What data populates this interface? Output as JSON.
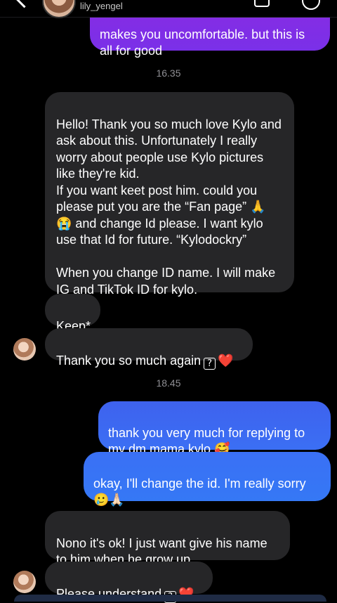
{
  "header": {
    "username": "lily_yengel"
  },
  "messages": [
    {
      "id": "m0",
      "type": "sent",
      "text": "makes you uncomfortable. but this is\nall for good"
    },
    {
      "id": "t1",
      "type": "time",
      "text": "16.35"
    },
    {
      "id": "m1",
      "type": "received",
      "text": "Hello! Thank you so much love Kylo and ask about this. Unfortunately I really worry about people use Kylo pictures like they're kid.\nIf you want keet post him. could you please put you are the “Fan page” 🙏 😭 and change Id please. I want kylo use that Id for future. “Kylodockry”\n\nWhen you change ID name. I will make IG and TikTok ID for kylo."
    },
    {
      "id": "m2",
      "type": "received",
      "text": "Keep*"
    },
    {
      "id": "m3",
      "type": "received",
      "text": "Thank you so much again",
      "trailing": "?",
      "heart": "❤️"
    },
    {
      "id": "t2",
      "type": "time",
      "text": "18.45"
    },
    {
      "id": "m4",
      "type": "sent",
      "text": "thank you very much for replying to my dm mama kylo 🥰"
    },
    {
      "id": "m5",
      "type": "sent",
      "text": "okay, I'll change the id. I'm really sorry 🥲🙏🏻"
    },
    {
      "id": "m6",
      "type": "received",
      "text": "Nono it's ok! I just want give his name to him when he grow up"
    },
    {
      "id": "m7",
      "type": "received",
      "text": "Please understand",
      "trailing": "?",
      "heart": "❤️"
    }
  ],
  "colors": {
    "received_bubble": "#262628",
    "sent_bubble_top": "#7a28e0",
    "sent_bubble_blue": "#3a6cf3",
    "background": "#000000"
  },
  "icons": [
    "back-icon",
    "video-call-icon",
    "info-icon"
  ]
}
